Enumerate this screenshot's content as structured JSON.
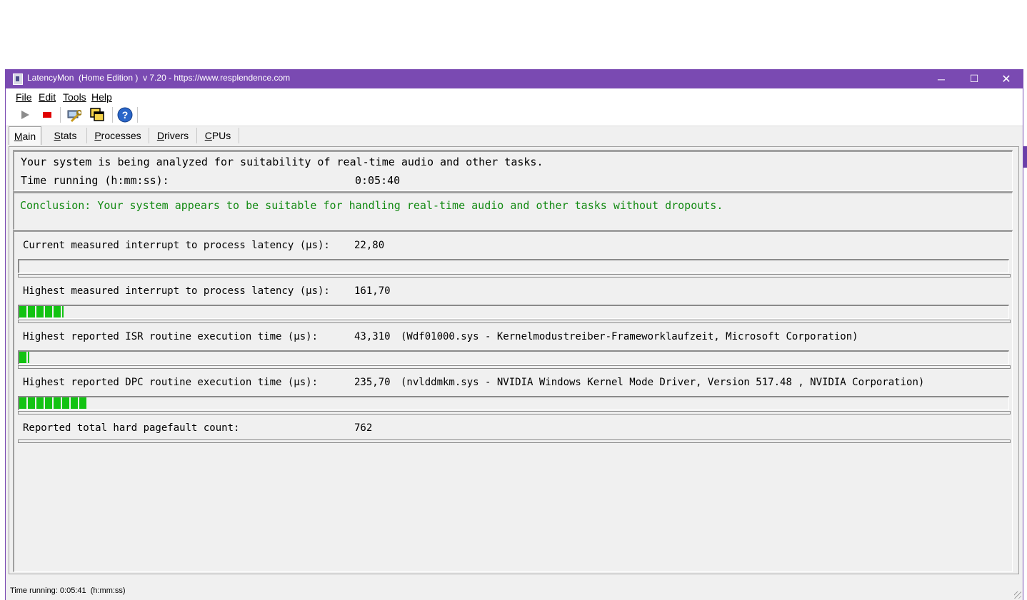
{
  "window": {
    "title": "LatencyMon  (Home Edition )  v 7.20 - https://www.resplendence.com",
    "controls": {
      "minimize": "─",
      "maximize": "☐",
      "close": "✕"
    }
  },
  "menu": [
    "File",
    "Edit",
    "Tools",
    "Help"
  ],
  "toolbar": {
    "icons": [
      "play-icon",
      "stop-icon",
      "wrench-icon",
      "windows-icon",
      "help-icon"
    ],
    "colors": {
      "stop": "#e00000",
      "help": "#2a66c9"
    }
  },
  "tabs": [
    "Main",
    "Stats",
    "Processes",
    "Drivers",
    "CPUs"
  ],
  "status": {
    "analyzing": "Your system is being analyzed for suitability of real-time audio and other tasks.",
    "time_label": "Time running (h:mm:ss):",
    "time_value": "0:05:40"
  },
  "conclusion": "Conclusion: Your system appears to be suitable for handling real-time audio and other tasks without dropouts.",
  "metrics": [
    {
      "label": "Current measured interrupt to process latency (µs):",
      "value": "22,80",
      "detail": "",
      "bar_fraction": 0.0
    },
    {
      "label": "Highest measured interrupt to process latency (µs):",
      "value": "161,70",
      "detail": "",
      "bar_fraction": 0.045
    },
    {
      "label": "Highest reported ISR routine execution time (µs):",
      "value": "43,310",
      "detail": "(Wdf01000.sys - Kernelmodustreiber-Frameworklaufzeit, Microsoft Corporation)",
      "bar_fraction": 0.01
    },
    {
      "label": "Highest reported DPC routine execution time (µs):",
      "value": "235,70",
      "detail": "(nvlddmkm.sys - NVIDIA Windows Kernel Mode Driver, Version 517.48 , NVIDIA Corporation)",
      "bar_fraction": 0.068
    }
  ],
  "pagefault": {
    "label": "Reported total hard pagefault count:",
    "value": "762"
  },
  "statusbar": "Time running: 0:05:41  (h:mm:ss)",
  "colors": {
    "titlebar": "#7a4ab2",
    "conclusion": "#138a13",
    "bar": "#12c312"
  }
}
